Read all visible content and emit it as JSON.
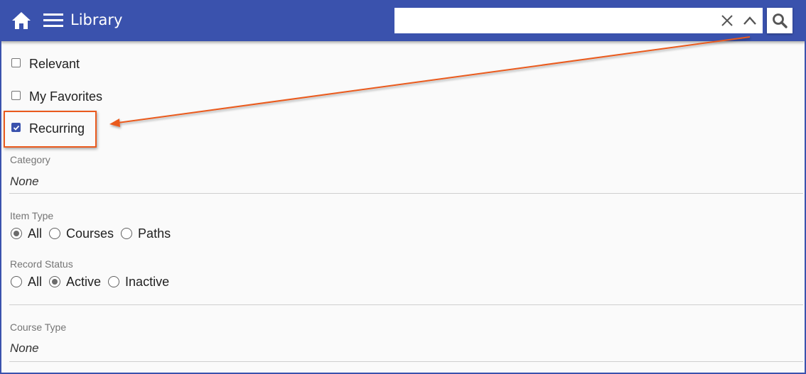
{
  "header": {
    "title": "Library",
    "icons": {
      "home": "home-icon",
      "menu": "hamburger-menu-icon",
      "clear": "close-icon",
      "collapse": "chevron-up-icon",
      "search": "search-icon"
    },
    "search": {
      "value": "",
      "placeholder": ""
    },
    "brand_color": "#3a52ad"
  },
  "filters": {
    "checkboxes": [
      {
        "label": "Relevant",
        "checked": false
      },
      {
        "label": "My Favorites",
        "checked": false
      },
      {
        "label": "Recurring",
        "checked": true
      }
    ],
    "category": {
      "label": "Category",
      "value": "None"
    },
    "item_type": {
      "label": "Item Type",
      "options": [
        {
          "label": "All",
          "selected": true
        },
        {
          "label": "Courses",
          "selected": false
        },
        {
          "label": "Paths",
          "selected": false
        }
      ]
    },
    "record_status": {
      "label": "Record Status",
      "options": [
        {
          "label": "All",
          "selected": false
        },
        {
          "label": "Active",
          "selected": true
        },
        {
          "label": "Inactive",
          "selected": false
        }
      ]
    },
    "course_type": {
      "label": "Course Type",
      "value": "None"
    }
  },
  "annotation": {
    "color": "#ea5a1e",
    "target": "Recurring checkbox"
  }
}
